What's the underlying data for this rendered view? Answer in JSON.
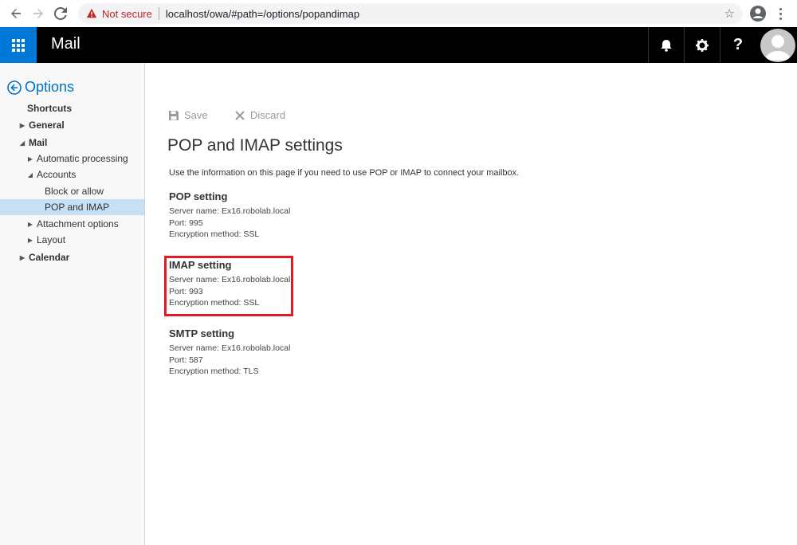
{
  "browser": {
    "not_secure": "Not secure",
    "url": "localhost/owa/#path=/options/popandimap"
  },
  "topbar": {
    "app_title": "Mail"
  },
  "leftnav": {
    "header": "Options",
    "items": [
      {
        "label": "Shortcuts"
      },
      {
        "label": "General"
      },
      {
        "label": "Mail"
      },
      {
        "label": "Automatic processing"
      },
      {
        "label": "Accounts"
      },
      {
        "label": "Block or allow"
      },
      {
        "label": "POP and IMAP"
      },
      {
        "label": "Attachment options"
      },
      {
        "label": "Layout"
      },
      {
        "label": "Calendar"
      }
    ]
  },
  "commands": {
    "save": "Save",
    "discard": "Discard"
  },
  "page": {
    "title": "POP and IMAP settings",
    "intro": "Use the information on this page if you need to use POP or IMAP to connect your mailbox."
  },
  "sections": [
    {
      "heading": "POP setting",
      "server": "Server name: Ex16.robolab.local",
      "port": "Port: 995",
      "encryption": "Encryption method: SSL"
    },
    {
      "heading": "IMAP setting",
      "server": "Server name: Ex16.robolab.local",
      "port": "Port: 993",
      "encryption": "Encryption method: SSL"
    },
    {
      "heading": "SMTP setting",
      "server": "Server name: Ex16.robolab.local",
      "port": "Port: 587",
      "encryption": "Encryption method: TLS"
    }
  ],
  "colors": {
    "accent": "#0078d7",
    "options_link": "#0072c6",
    "highlight": "#e01b24",
    "selected_nav": "#c7e0f4"
  }
}
